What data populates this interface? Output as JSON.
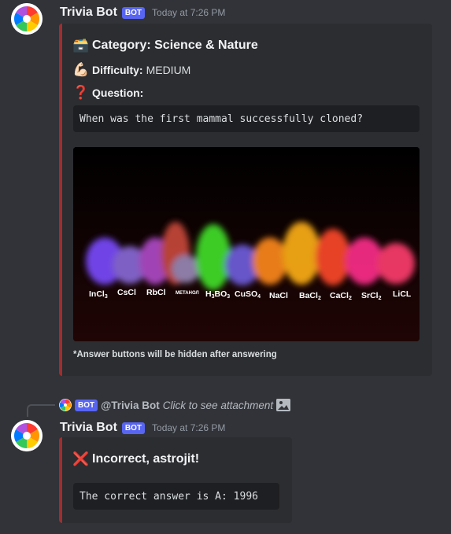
{
  "messages": [
    {
      "author": "Trivia Bot",
      "bot_tag": "BOT",
      "timestamp": "Today at 7:26 PM",
      "embed": {
        "title_emoji": "🗃️",
        "title": "Category: Science & Nature",
        "difficulty_emoji": "💪🏻",
        "difficulty_label": "Difficulty:",
        "difficulty_value": "MEDIUM",
        "question_emoji": "❓",
        "question_label": "Question:",
        "question_text": "When was the first mammal successfully cloned?",
        "image_labels": [
          "InCl3",
          "CsCl",
          "RbCl",
          "Метанол",
          "H3BO3",
          "CuSO4",
          "NaCl",
          "BaCl2",
          "CaCl2",
          "SrCl2",
          "LiCl"
        ],
        "footer": "*Answer buttons will be hidden after answering"
      }
    },
    {
      "reply": {
        "bot_tag": "BOT",
        "name": "@Trivia Bot",
        "text": "Click to see attachment"
      },
      "author": "Trivia Bot",
      "bot_tag": "BOT",
      "timestamp": "Today at 7:26 PM",
      "embed": {
        "title_emoji": "❌",
        "title": "Incorrect, astrojit!",
        "answer_text": "The correct answer is A: 1996"
      }
    }
  ],
  "colors": {
    "embed_border": "#a12d2f",
    "bot_tag": "#5865f2",
    "background": "#313338",
    "embed_bg": "#2b2d31"
  }
}
